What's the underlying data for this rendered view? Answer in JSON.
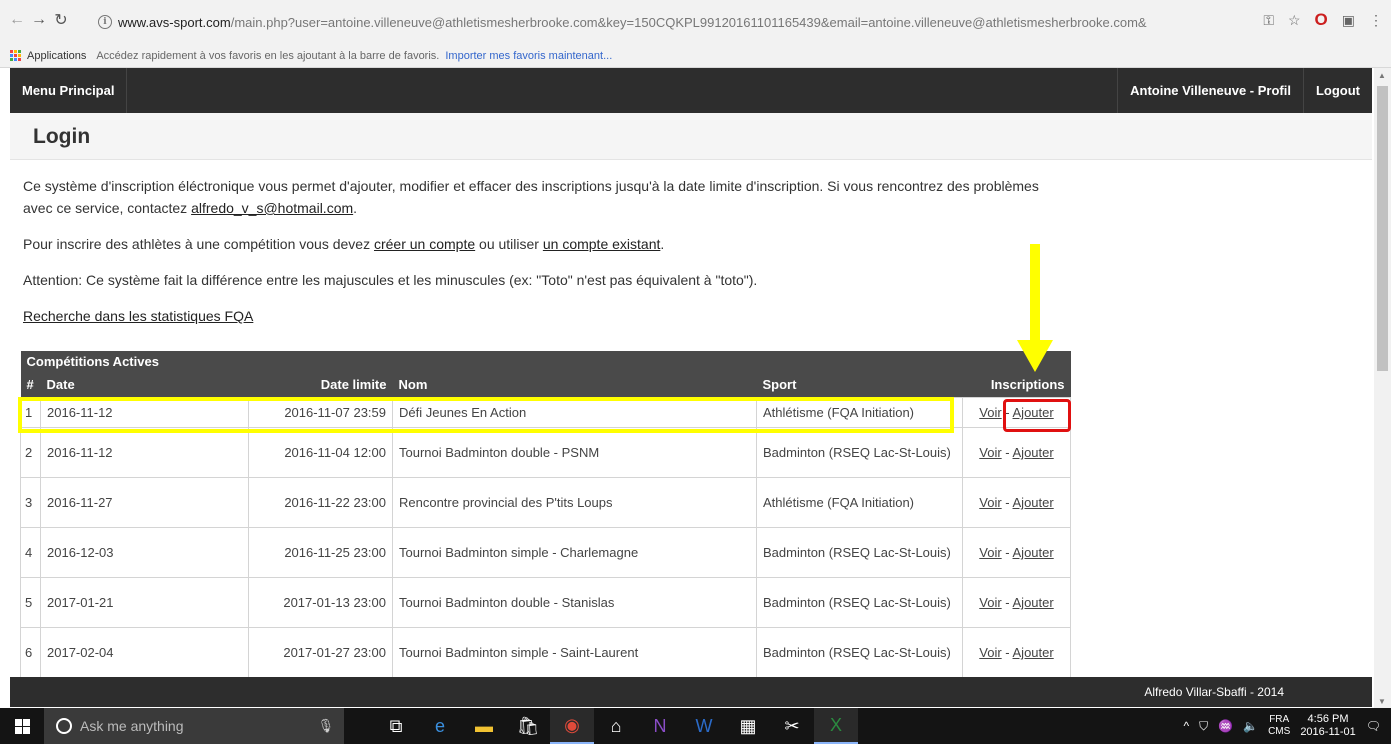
{
  "browser": {
    "url_host": "www.avs-sport.com",
    "url_path": "/main.php?user=antoine.villeneuve@athletismesherbrooke.com&key=150CQKPL99120161101165439&email=antoine.villeneuve@athletismesherbrooke.com&",
    "bookmarks_apps": "Applications",
    "bookmarks_hint": "Accédez rapidement à vos favoris en les ajoutant à la barre de favoris.",
    "bookmarks_import": "Importer mes favoris maintenant..."
  },
  "header": {
    "menu": "Menu Principal",
    "profile": "Antoine Villeneuve - Profil",
    "logout": "Logout"
  },
  "page": {
    "title": "Login",
    "intro_1": "Ce système d'inscription éléctronique vous permet d'ajouter, modifier et effacer des inscriptions jusqu'à la date limite d'inscription. Si vous rencontrez des problèmes avec ce service, contactez ",
    "email": "alfredo_v_s@hotmail.com",
    "intro_1_end": ".",
    "intro_2": "Pour inscrire des athlètes à une compétition vous devez ",
    "create_account": "créer un compte",
    "or_use": " ou utiliser ",
    "existing_account": "un compte existant",
    "intro_2_end": ".",
    "attention": "Attention: Ce système fait la différence entre les majuscules et les minuscules (ex: \"Toto\" n'est pas équivalent à \"toto\").",
    "search_stats": "Recherche dans les statistiques FQA"
  },
  "table": {
    "caption": "Compétitions Actives",
    "headers": [
      "#",
      "Date",
      "Date limite",
      "Nom",
      "Sport",
      "Inscriptions"
    ],
    "view_label": "Voir",
    "sep": " - ",
    "add_label": "Ajouter",
    "rows": [
      {
        "num": "1",
        "date": "2016-11-12",
        "deadline": "2016-11-07 23:59",
        "name": "Défi Jeunes En Action",
        "sport": "Athlétisme (FQA Initiation)"
      },
      {
        "num": "2",
        "date": "2016-11-12",
        "deadline": "2016-11-04 12:00",
        "name": "Tournoi Badminton double - PSNM",
        "sport": "Badminton (RSEQ Lac-St-Louis)"
      },
      {
        "num": "3",
        "date": "2016-11-27",
        "deadline": "2016-11-22 23:00",
        "name": "Rencontre provincial des P'tits Loups",
        "sport": "Athlétisme (FQA Initiation)"
      },
      {
        "num": "4",
        "date": "2016-12-03",
        "deadline": "2016-11-25 23:00",
        "name": "Tournoi Badminton simple - Charlemagne",
        "sport": "Badminton (RSEQ Lac-St-Louis)"
      },
      {
        "num": "5",
        "date": "2017-01-21",
        "deadline": "2017-01-13 23:00",
        "name": "Tournoi Badminton double - Stanislas",
        "sport": "Badminton (RSEQ Lac-St-Louis)"
      },
      {
        "num": "6",
        "date": "2017-02-04",
        "deadline": "2017-01-27 23:00",
        "name": "Tournoi Badminton simple - Saint-Laurent",
        "sport": "Badminton (RSEQ Lac-St-Louis)"
      }
    ]
  },
  "footer": {
    "text": "Alfredo Villar-Sbaffi - 2014"
  },
  "taskbar": {
    "search_placeholder": "Ask me anything",
    "lang": "FRA",
    "lang_sub": "CMS",
    "time": "4:56 PM",
    "date": "2016-11-01"
  },
  "colors": {
    "header_bg": "#2d2d2d",
    "highlight_yellow": "#ffff00",
    "highlight_red": "#e01010"
  }
}
